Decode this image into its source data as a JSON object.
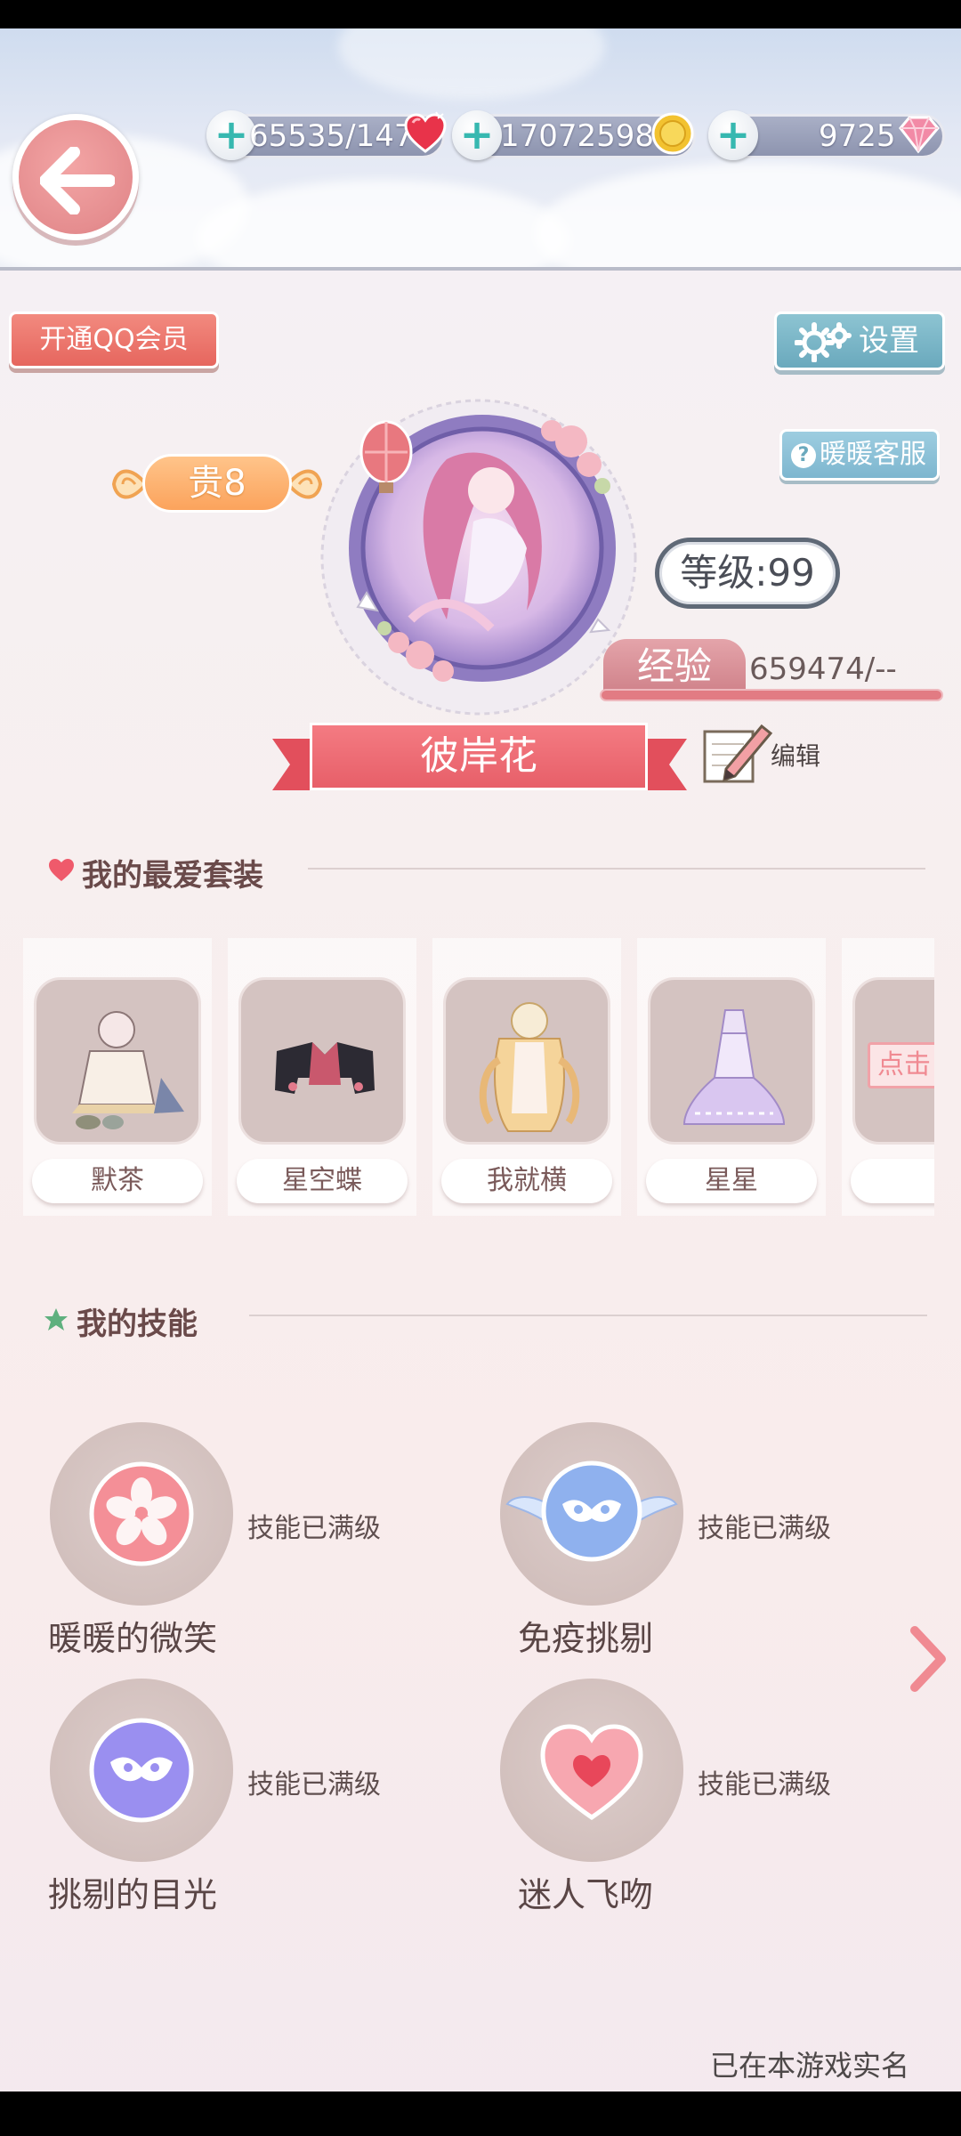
{
  "resources": {
    "stamina": "65535/147",
    "coins": "17072598",
    "diamonds": "9725",
    "plus_symbol": "+"
  },
  "buttons": {
    "qq_member": "开通QQ会员",
    "settings": "设置",
    "customer_service": "暖暖客服",
    "edit": "编辑"
  },
  "profile": {
    "vip": "贵8",
    "level": "等级:99",
    "exp_label": "经验",
    "exp_value": "659474/--",
    "exp_progress": 1.0,
    "name": "彼岸花"
  },
  "favorites": {
    "title": "我的最爱套装",
    "items": [
      {
        "name": "默茶"
      },
      {
        "name": "星空蝶"
      },
      {
        "name": "我就横"
      },
      {
        "name": "星星"
      },
      {
        "name": "",
        "tag": "点击"
      }
    ]
  },
  "skills": {
    "title": "我的技能",
    "items": [
      {
        "name": "暖暖的微笑",
        "status": "技能已满级",
        "icon": "sakura-icon"
      },
      {
        "name": "免疫挑剔",
        "status": "技能已满级",
        "icon": "winged-mask-icon"
      },
      {
        "name": "挑剔的目光",
        "status": "技能已满级",
        "icon": "mask-icon"
      },
      {
        "name": "迷人飞吻",
        "status": "技能已满级",
        "icon": "heart-icon"
      }
    ]
  },
  "footer": {
    "realname": "已在本游戏实名"
  },
  "colors": {
    "accent_pink": "#e75f69",
    "accent_teal": "#6aa9bd",
    "vip_orange": "#fba35c"
  }
}
